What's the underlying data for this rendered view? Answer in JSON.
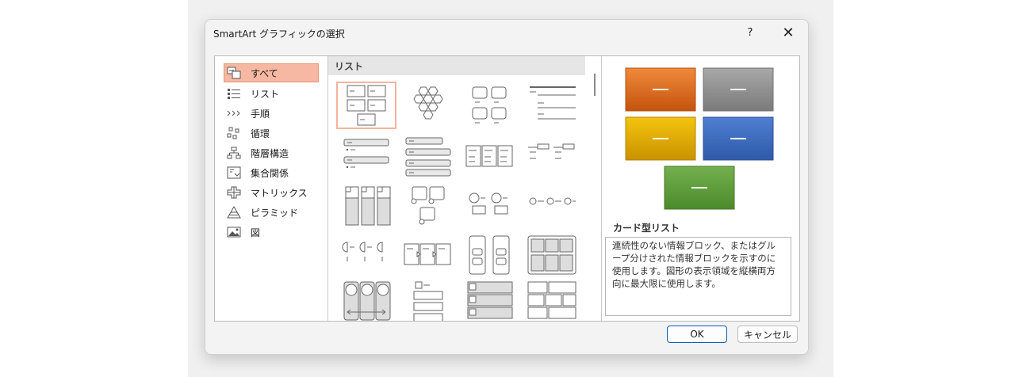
{
  "window": {
    "title": "SmartArt グラフィックの選択",
    "help_label": "?",
    "close_label": "✕"
  },
  "categories": [
    {
      "label": "すべて",
      "icon": "all-icon",
      "selected": true
    },
    {
      "label": "リスト",
      "icon": "list-icon"
    },
    {
      "label": "手順",
      "icon": "process-icon"
    },
    {
      "label": "循環",
      "icon": "cycle-icon"
    },
    {
      "label": "階層構造",
      "icon": "hierarchy-icon"
    },
    {
      "label": "集合関係",
      "icon": "relationship-icon"
    },
    {
      "label": "マトリックス",
      "icon": "matrix-icon"
    },
    {
      "label": "ピラミッド",
      "icon": "pyramid-icon"
    },
    {
      "label": "図",
      "icon": "picture-icon"
    }
  ],
  "gallery": {
    "section_header": "リスト"
  },
  "preview": {
    "colors": {
      "orange": "#e06a1a",
      "gray": "#8a8a8a",
      "yellow": "#e0a800",
      "blue": "#3f6cc0",
      "green": "#5f9e3c"
    },
    "title": "カード型リスト",
    "description": "連続性のない情報ブロック、またはグループ分けされた情報ブロックを示すのに使用します。図形の表示領域を縦横両方向に最大限に使用します。"
  },
  "buttons": {
    "ok_label": "OK",
    "cancel_label": "キャンセル"
  }
}
